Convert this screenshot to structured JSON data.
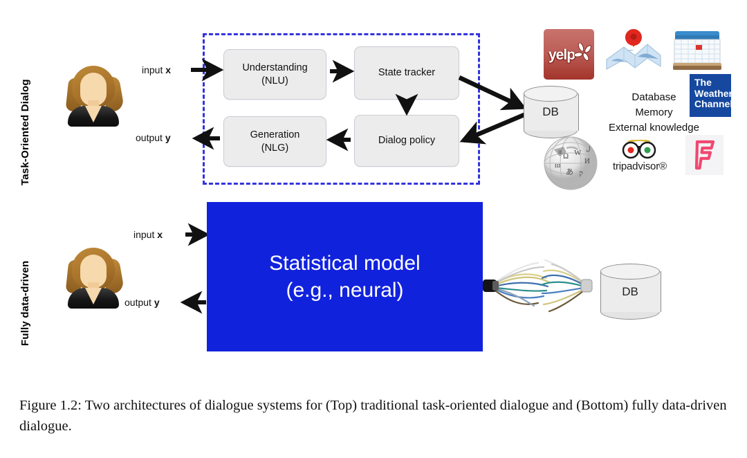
{
  "figure": {
    "caption": "Figure 1.2: Two architectures of dialogue systems for (Top) traditional task-oriented dialogue and (Bottom) fully data-driven dialogue."
  },
  "rows": {
    "top": {
      "label": "Task-Oriented Dialog",
      "input_label": "input x",
      "input_var": "x",
      "input_text": "input ",
      "output_text": "output ",
      "output_var": "y",
      "modules": [
        {
          "name": "understanding",
          "line1": "Understanding",
          "line2": "(NLU)"
        },
        {
          "name": "state-tracker",
          "line1": "State tracker",
          "line2": ""
        },
        {
          "name": "generation",
          "line1": "Generation",
          "line2": "(NLG)"
        },
        {
          "name": "dialog-policy",
          "line1": "Dialog policy",
          "line2": ""
        }
      ],
      "db_label": "DB"
    },
    "bottom": {
      "label": "Fully data-driven",
      "input_text": "input ",
      "input_var": "x",
      "output_text": "output ",
      "output_var": "y",
      "model_line1": "Statistical model",
      "model_line2": "(e.g., neural)",
      "db_label": "DB"
    }
  },
  "knowledge": {
    "lines": [
      "Database",
      "Memory",
      "External knowledge"
    ],
    "logos": [
      {
        "name": "yelp-logo",
        "text": "yelp"
      },
      {
        "name": "maps-logo",
        "text": ""
      },
      {
        "name": "calendar-logo",
        "text": ""
      },
      {
        "name": "weather-channel-logo",
        "text": "The Weather Channel"
      },
      {
        "name": "wikipedia-globe-logo",
        "text": ""
      },
      {
        "name": "tripadvisor-logo",
        "text": "tripadvisor®"
      },
      {
        "name": "foursquare-logo",
        "text": "F"
      }
    ]
  },
  "colors": {
    "model_blue": "#1122dd",
    "dashed_border": "#3333dd",
    "module_fill": "#ececec",
    "weather_blue": "#15489e",
    "yelp_red": "#a3342b",
    "foursquare_pink": "#f1486f"
  }
}
